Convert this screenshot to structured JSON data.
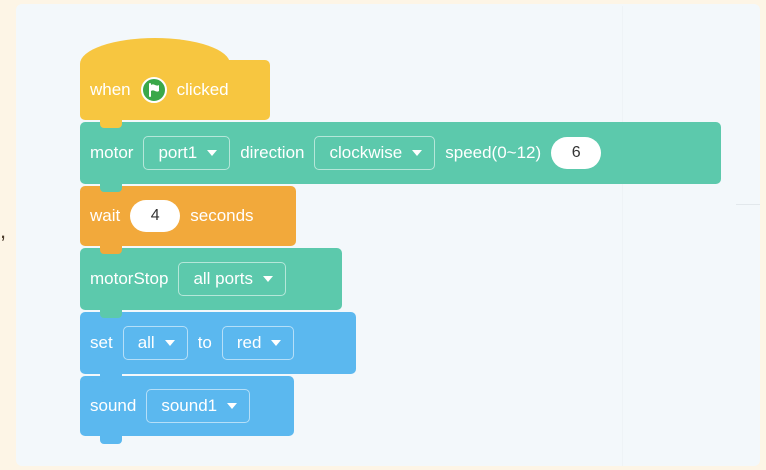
{
  "blocks": {
    "when_clicked": {
      "prefix": "when",
      "suffix": "clicked",
      "icon": "green-flag-icon"
    },
    "motor": {
      "label": "motor",
      "port": "port1",
      "direction_label": "direction",
      "direction": "clockwise",
      "speed_label": "speed(0~12)",
      "speed": "6"
    },
    "wait": {
      "label": "wait",
      "seconds": "4",
      "unit": "seconds"
    },
    "motor_stop": {
      "label": "motorStop",
      "ports": "all ports"
    },
    "set_light": {
      "label": "set",
      "target": "all",
      "to_label": "to",
      "color": "red"
    },
    "sound": {
      "label": "sound",
      "sound": "sound1"
    }
  },
  "colors": {
    "event_yellow": "#f7c640",
    "motion_green": "#5cc9ac",
    "control_orange": "#f2a93b",
    "looks_blue": "#5bb8ef",
    "flag_green": "#3aa84a",
    "page_background": "#fdf5e6",
    "workspace_background": "#f3f8fb"
  }
}
